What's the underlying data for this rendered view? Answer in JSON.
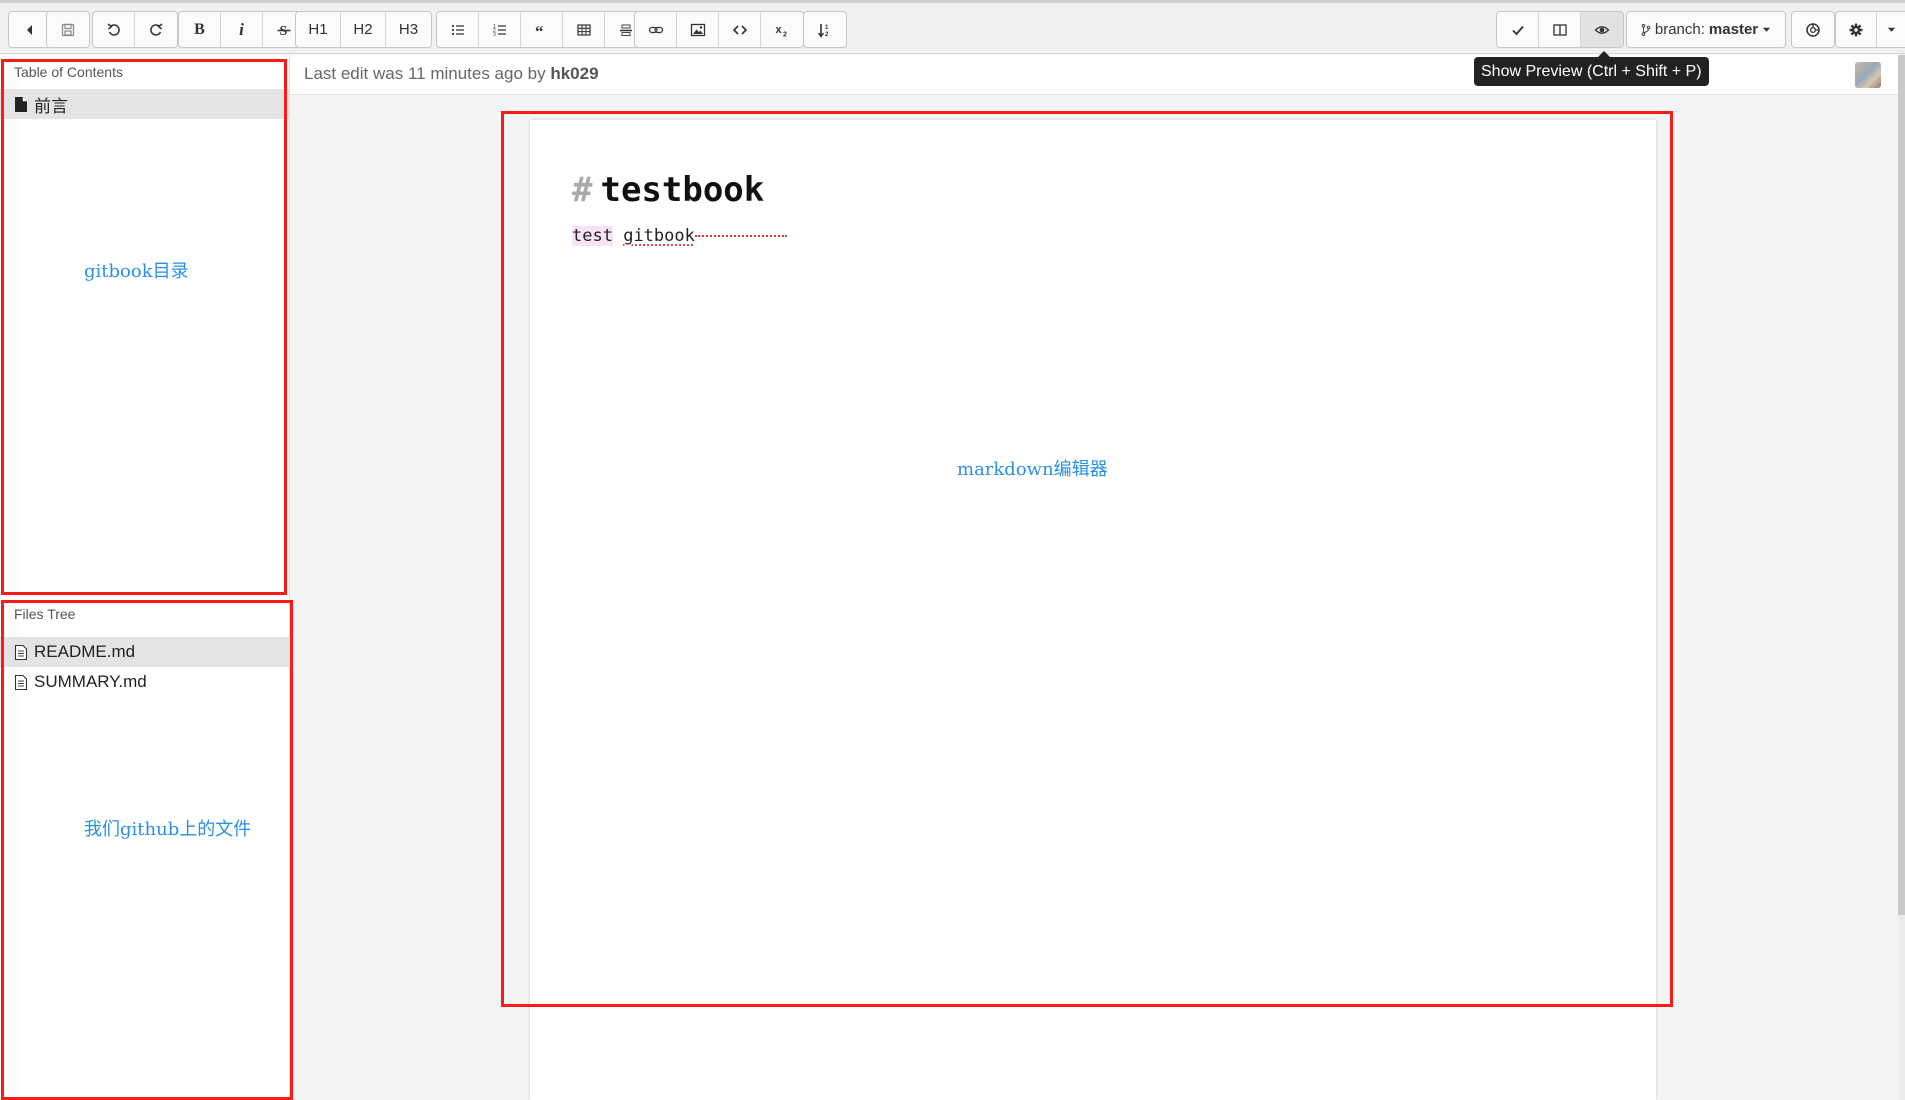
{
  "toolbar": {
    "buttons": {
      "heading1": "H1",
      "heading2": "H2",
      "heading3": "H3",
      "bold": "B",
      "italic": "i"
    },
    "branch_prefix": "branch:",
    "branch_name": "master"
  },
  "tooltip": "Show Preview (Ctrl + Shift + P)",
  "sidebar": {
    "toc_title": "Table of Contents",
    "toc_items": [
      {
        "label": "前言",
        "icon": "file-solid-icon",
        "active": true
      }
    ],
    "files_title": "Files Tree",
    "files": [
      {
        "label": "README.md",
        "icon": "file-text-icon",
        "active": true
      },
      {
        "label": "SUMMARY.md",
        "icon": "file-text-icon",
        "active": false
      }
    ]
  },
  "status": {
    "prefix": "Last edit was 11 minutes ago by",
    "user": "hk029"
  },
  "editor": {
    "heading_marker": "#",
    "heading_text": "testbook",
    "line_word1": "test",
    "line_word2": "gitbook"
  },
  "annotations": {
    "toc": "gitbook目录",
    "files": "我们github上的文件",
    "editor": "markdown编辑器",
    "color": "#ff1a1a",
    "text_color": "#2b8fe8"
  }
}
